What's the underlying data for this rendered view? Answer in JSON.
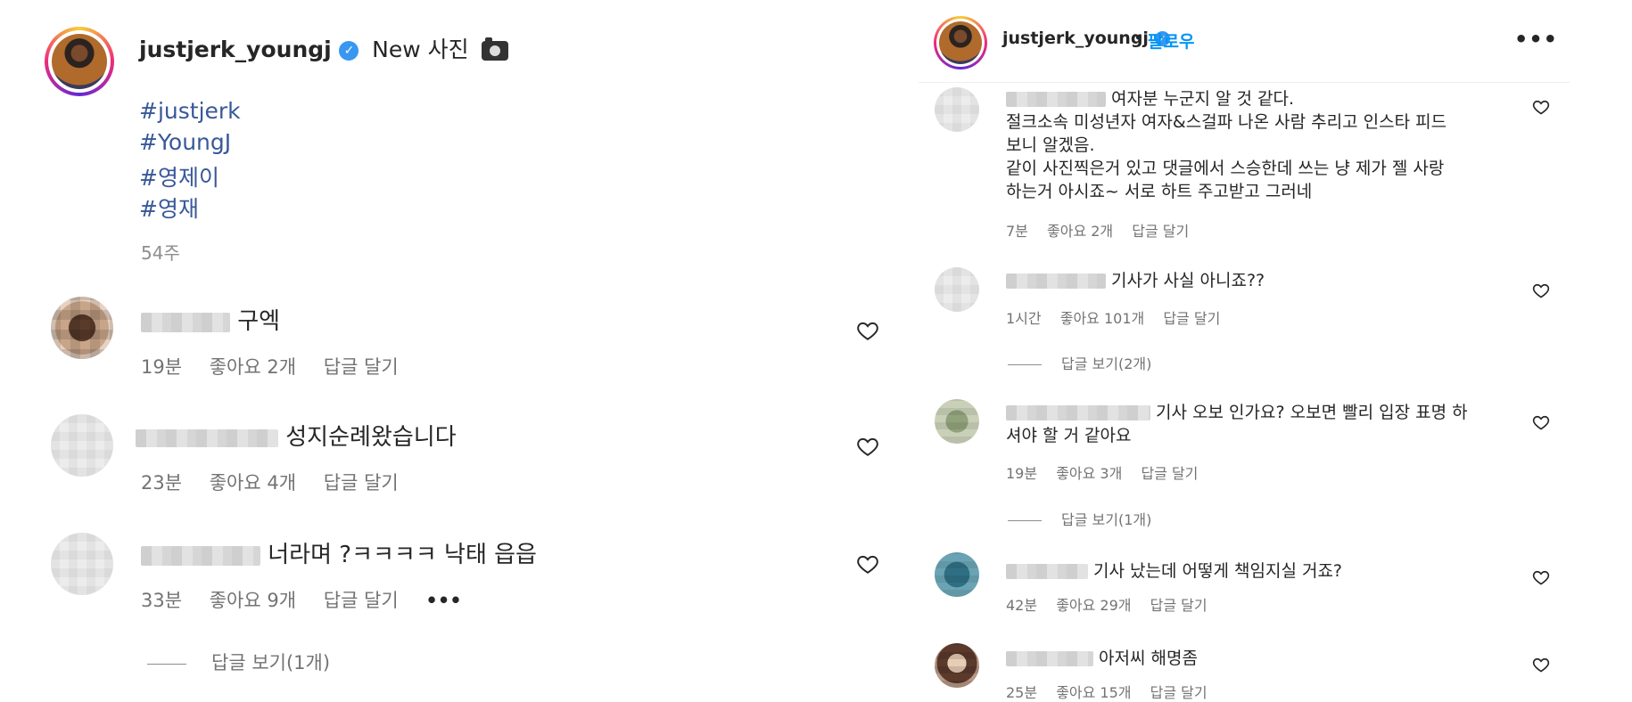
{
  "left": {
    "post": {
      "username": "justjerk_youngj",
      "caption": "New 사진",
      "hashtags": [
        "#justjerk",
        "#YoungJ",
        "#영제이",
        "#영재"
      ],
      "time": "54주"
    },
    "comments": [
      {
        "text": "구엑",
        "time": "19분",
        "likes": "좋아요 2개",
        "reply": "답글 달기"
      },
      {
        "text": "성지순례왔습니다",
        "time": "23분",
        "likes": "좋아요 4개",
        "reply": "답글 달기"
      },
      {
        "text": "너라며 ?ㅋㅋㅋㅋ 낙태 읍읍",
        "time": "33분",
        "likes": "좋아요 9개",
        "reply": "답글 달기",
        "more": "•••",
        "view_replies": "답글 보기(1개)"
      }
    ]
  },
  "right": {
    "header": {
      "username": "justjerk_youngj",
      "separator": "•",
      "follow": "팔로우",
      "more": "•••"
    },
    "comments": [
      {
        "lines": [
          "여자분 누군지 알 것 같다.",
          "절크소속 미성년자 여자&스걸파 나온 사람 추리고 인스타 피드",
          "보니 알겠음.",
          "같이 사진찍은거 있고 댓글에서 스승한데 쓰는 냥 제가 젤 사랑",
          "하는거 아시죠~ 서로 하트 주고받고 그러네"
        ],
        "time": "7분",
        "likes": "좋아요 2개",
        "reply": "답글 달기"
      },
      {
        "lines": [
          "기사가 사실 아니죠??"
        ],
        "time": "1시간",
        "likes": "좋아요 101개",
        "reply": "답글 달기",
        "view_replies": "답글 보기(2개)"
      },
      {
        "lines": [
          "기사 오보 인가요? 오보면 빨리 입장 표명 하",
          "셔야 할 거 같아요"
        ],
        "time": "19분",
        "likes": "좋아요 3개",
        "reply": "답글 달기",
        "view_replies": "답글 보기(1개)"
      },
      {
        "lines": [
          "기사 났는데 어떻게 책임지실 거죠?"
        ],
        "time": "42분",
        "likes": "좋아요 29개",
        "reply": "답글 달기"
      },
      {
        "lines": [
          "아저씨 해명좀"
        ],
        "time": "25분",
        "likes": "좋아요 15개",
        "reply": "답글 달기"
      }
    ]
  },
  "colors": {
    "verified": "#3897f0",
    "hashtag": "#385898",
    "follow": "#0095f6",
    "meta": "#737373"
  }
}
